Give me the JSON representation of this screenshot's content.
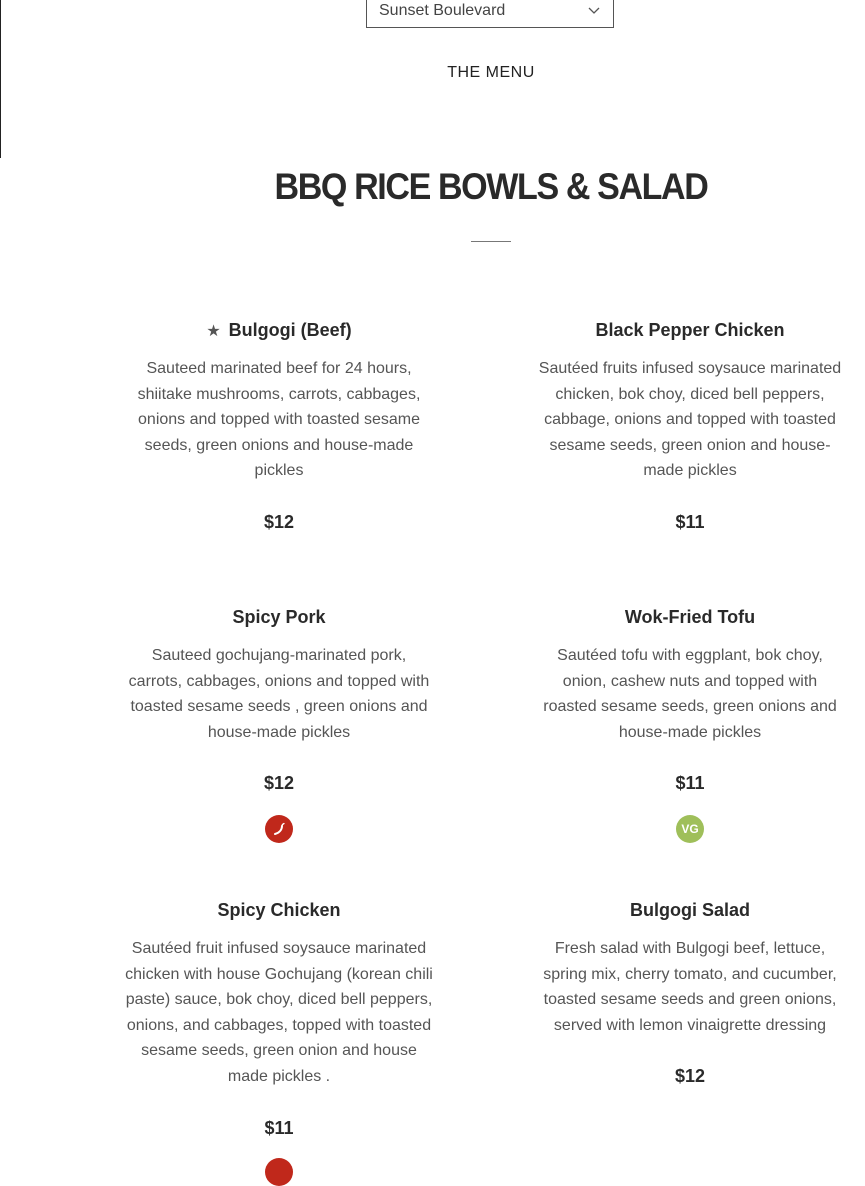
{
  "location": {
    "selected": "Sunset Boulevard"
  },
  "nav": {
    "menu_label": "THE MENU"
  },
  "section": {
    "title": "BBQ RICE BOWLS & SALAD"
  },
  "items": [
    {
      "name": "Bulgogi (Beef)",
      "starred": true,
      "star_glyph": "★",
      "description": "Sauteed marinated beef for 24 hours, shiitake mushrooms, carrots, cabbages, onions and topped with toasted sesame seeds, green onions and house-made pickles",
      "price": "$12",
      "badge": null
    },
    {
      "name": "Black Pepper Chicken",
      "starred": false,
      "description": "Sautéed fruits infused soysauce marinated chicken, bok choy, diced bell peppers, cabbage, onions and topped with toasted sesame seeds, green onion and house-made pickles",
      "price": "$11",
      "badge": null
    },
    {
      "name": "Spicy Pork",
      "starred": false,
      "description": "Sauteed gochujang-marinated pork, carrots, cabbages, onions and topped with toasted sesame seeds , green onions and house-made pickles",
      "price": "$12",
      "badge": "spicy-pepper-icon"
    },
    {
      "name": "Wok-Fried Tofu",
      "starred": false,
      "description": "Sautéed tofu with eggplant, bok choy, onion, cashew nuts and topped with roasted sesame seeds, green onions and house-made pickles",
      "price": "$11",
      "badge": "vegan-icon",
      "badge_text": "VG"
    },
    {
      "name": "Spicy Chicken",
      "starred": false,
      "description": "Sautéed fruit infused soysauce marinated chicken with house Gochujang (korean chili paste) sauce, bok choy, diced bell peppers, onions, and cabbages, topped with toasted sesame seeds, green onion and house made pickles .",
      "price": "$11",
      "badge": "spicy-pepper-icon"
    },
    {
      "name": "Bulgogi Salad",
      "starred": false,
      "description": "Fresh salad with Bulgogi beef, lettuce, spring mix, cherry tomato, and cucumber, toasted sesame seeds and green onions, served with lemon vinaigrette dressing",
      "price": "$12",
      "badge": null
    }
  ],
  "colors": {
    "spicy_badge": "#c0281b",
    "vegan_badge": "#9fbf5a",
    "heading": "#2a2a2a",
    "description": "#555555"
  }
}
